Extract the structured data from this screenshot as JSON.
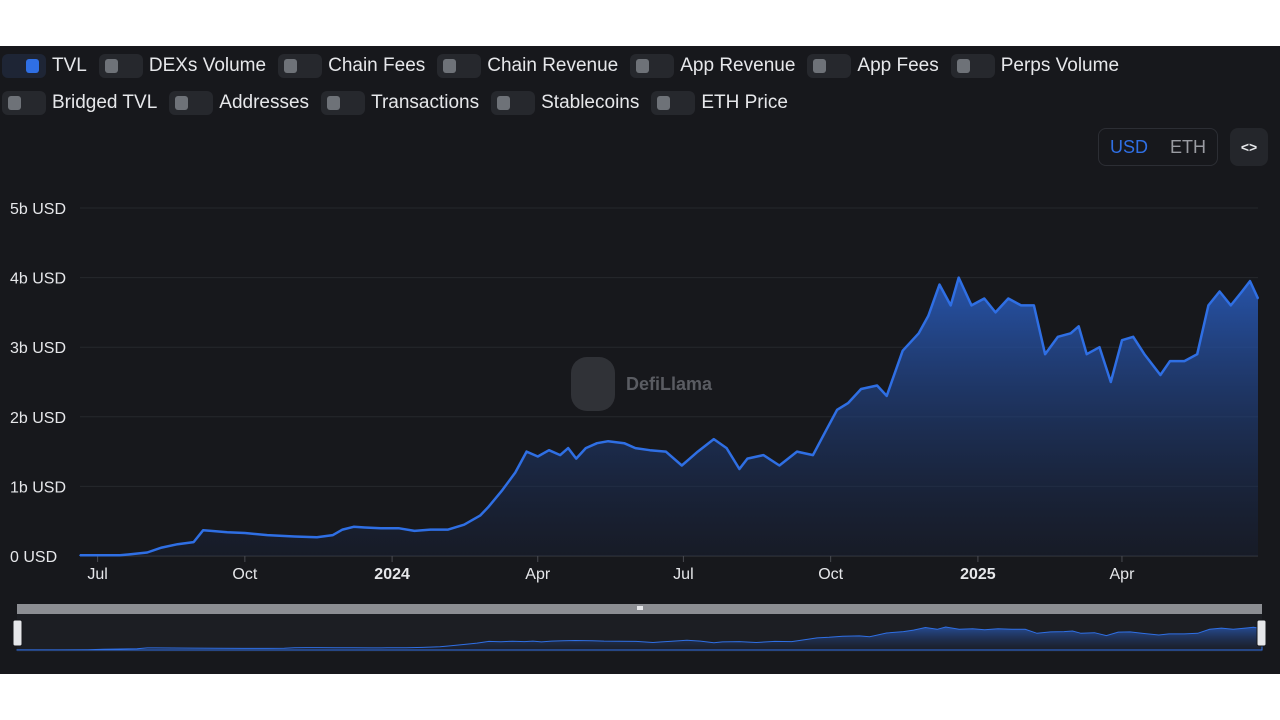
{
  "toggles_row1": [
    {
      "label": "TVL",
      "on": true
    },
    {
      "label": "DEXs Volume",
      "on": false
    },
    {
      "label": "Chain Fees",
      "on": false
    },
    {
      "label": "Chain Revenue",
      "on": false
    },
    {
      "label": "App Revenue",
      "on": false
    },
    {
      "label": "App Fees",
      "on": false
    },
    {
      "label": "Perps Volume",
      "on": false
    }
  ],
  "toggles_row2": [
    {
      "label": "Bridged TVL",
      "on": false
    },
    {
      "label": "Addresses",
      "on": false
    },
    {
      "label": "Transactions",
      "on": false
    },
    {
      "label": "Stablecoins",
      "on": false
    },
    {
      "label": "ETH Price",
      "on": false
    }
  ],
  "currency": {
    "usd": "USD",
    "eth": "ETH",
    "selected": "USD"
  },
  "embed_label": "<>",
  "watermark": "DefiLlama",
  "colors": {
    "line": "#2f6fe4",
    "background": "#17181c",
    "grid": "#26282d",
    "text": "#e6e7ea"
  },
  "chart_data": {
    "type": "area",
    "series": [
      {
        "name": "TVL",
        "x": [
          "2023-06-20",
          "2023-07-15",
          "2023-08-01",
          "2023-08-10",
          "2023-08-20",
          "2023-08-30",
          "2023-09-05",
          "2023-09-10",
          "2023-09-20",
          "2023-10-01",
          "2023-10-15",
          "2023-11-01",
          "2023-11-15",
          "2023-11-25",
          "2023-12-01",
          "2023-12-08",
          "2023-12-15",
          "2023-12-25",
          "2024-01-05",
          "2024-01-15",
          "2024-01-25",
          "2024-02-05",
          "2024-02-15",
          "2024-02-25",
          "2024-03-01",
          "2024-03-10",
          "2024-03-18",
          "2024-03-25",
          "2024-04-01",
          "2024-04-08",
          "2024-04-15",
          "2024-04-20",
          "2024-04-25",
          "2024-05-01",
          "2024-05-08",
          "2024-05-15",
          "2024-05-25",
          "2024-06-01",
          "2024-06-10",
          "2024-06-20",
          "2024-06-30",
          "2024-07-05",
          "2024-07-10",
          "2024-07-20",
          "2024-07-28",
          "2024-08-05",
          "2024-08-10",
          "2024-08-20",
          "2024-08-30",
          "2024-09-10",
          "2024-09-20",
          "2024-09-28",
          "2024-10-05",
          "2024-10-12",
          "2024-10-20",
          "2024-10-30",
          "2024-11-05",
          "2024-11-15",
          "2024-11-25",
          "2024-12-01",
          "2024-12-08",
          "2024-12-15",
          "2024-12-20",
          "2024-12-28",
          "2025-01-05",
          "2025-01-12",
          "2025-01-20",
          "2025-01-28",
          "2025-02-05",
          "2025-02-12",
          "2025-02-20",
          "2025-02-28",
          "2025-03-05",
          "2025-03-10",
          "2025-03-18",
          "2025-03-25",
          "2025-04-01",
          "2025-04-08",
          "2025-04-15",
          "2025-04-25",
          "2025-05-01",
          "2025-05-10",
          "2025-05-18",
          "2025-05-25",
          "2025-06-01",
          "2025-06-08",
          "2025-06-15",
          "2025-06-20",
          "2025-06-25"
        ],
        "values": [
          0.01,
          0.01,
          0.05,
          0.12,
          0.17,
          0.2,
          0.37,
          0.36,
          0.34,
          0.33,
          0.3,
          0.28,
          0.27,
          0.3,
          0.38,
          0.42,
          0.41,
          0.4,
          0.4,
          0.36,
          0.38,
          0.38,
          0.45,
          0.58,
          0.7,
          0.95,
          1.2,
          1.5,
          1.43,
          1.52,
          1.45,
          1.55,
          1.4,
          1.55,
          1.62,
          1.65,
          1.62,
          1.55,
          1.52,
          1.5,
          1.3,
          1.4,
          1.5,
          1.68,
          1.55,
          1.25,
          1.4,
          1.45,
          1.3,
          1.5,
          1.45,
          1.8,
          2.1,
          2.2,
          2.4,
          2.45,
          2.3,
          2.95,
          3.2,
          3.45,
          3.9,
          3.6,
          4.0,
          3.6,
          3.7,
          3.5,
          3.7,
          3.6,
          3.6,
          2.9,
          3.15,
          3.2,
          3.3,
          2.9,
          3.0,
          2.5,
          3.1,
          3.15,
          2.9,
          2.6,
          2.8,
          2.8,
          2.9,
          3.6,
          3.8,
          3.6,
          3.8,
          3.95,
          3.7
        ]
      }
    ],
    "yticks": [
      "0 USD",
      "1b USD",
      "2b USD",
      "3b USD",
      "4b USD",
      "5b USD"
    ],
    "ylim": [
      0,
      5
    ],
    "xticks": [
      {
        "label": "Jul",
        "date": "2023-07-01",
        "bold": false
      },
      {
        "label": "Oct",
        "date": "2023-10-01",
        "bold": false
      },
      {
        "label": "2024",
        "date": "2024-01-01",
        "bold": true
      },
      {
        "label": "Apr",
        "date": "2024-04-01",
        "bold": false
      },
      {
        "label": "Jul",
        "date": "2024-07-01",
        "bold": false
      },
      {
        "label": "Oct",
        "date": "2024-10-01",
        "bold": false
      },
      {
        "label": "2025",
        "date": "2025-01-01",
        "bold": true
      },
      {
        "label": "Apr",
        "date": "2025-04-01",
        "bold": false
      }
    ],
    "xlim": [
      "2023-06-20",
      "2025-06-25"
    ],
    "grid": true,
    "legend": "none"
  }
}
